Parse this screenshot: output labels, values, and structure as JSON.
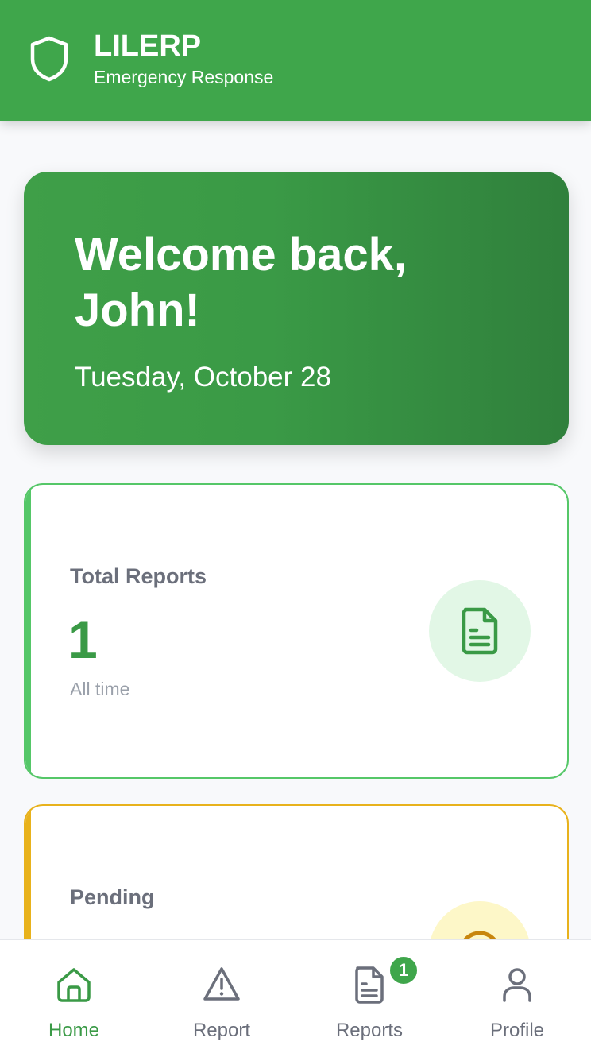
{
  "header": {
    "app_name": "LILERP",
    "subtitle": "Emergency Response",
    "logo_icon": "shield-icon"
  },
  "welcome": {
    "greeting": "Welcome back, John!",
    "date": "Tuesday, October 28"
  },
  "stats": [
    {
      "label": "Total Reports",
      "value": "1",
      "sub": "All time",
      "icon": "document-icon",
      "accent": "#55c768"
    },
    {
      "label": "Pending",
      "icon": "clock-icon",
      "accent": "#e8b21c"
    }
  ],
  "nav": {
    "items": [
      {
        "label": "Home",
        "icon": "home-icon",
        "active": true
      },
      {
        "label": "Report",
        "icon": "warning-icon"
      },
      {
        "label": "Reports",
        "icon": "document-icon",
        "badge": "1"
      },
      {
        "label": "Profile",
        "icon": "user-icon"
      }
    ]
  },
  "colors": {
    "primary": "#3fa64b",
    "primary_dark": "#30803c",
    "pending": "#e8b21c",
    "muted_text": "#6b6f7b"
  }
}
